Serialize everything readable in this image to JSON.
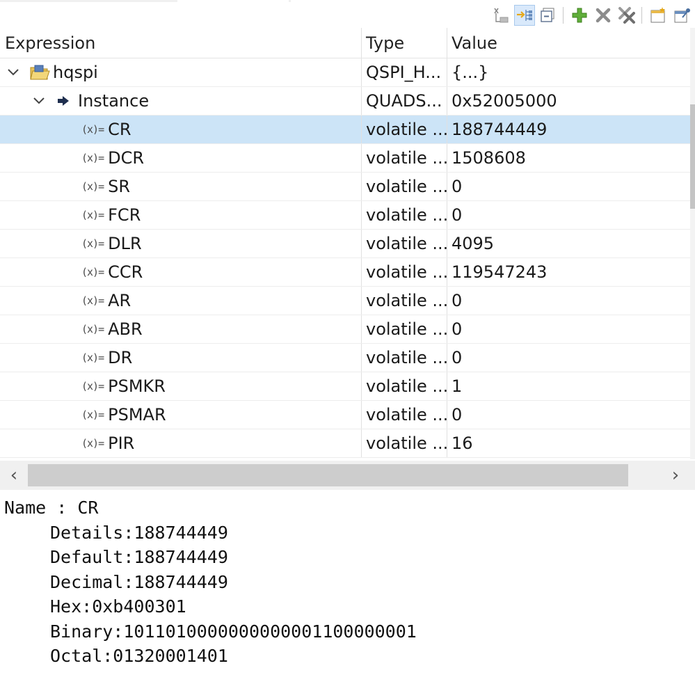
{
  "toolbar": {
    "buttons": [
      {
        "icon": "show-type-names-icon",
        "active": false
      },
      {
        "icon": "show-logical-structure-icon",
        "active": true
      },
      {
        "icon": "collapse-all-icon",
        "active": false
      },
      {
        "icon": "add-expression-icon",
        "active": false
      },
      {
        "icon": "remove-expression-icon",
        "active": false
      },
      {
        "icon": "remove-all-expressions-icon",
        "active": false
      },
      {
        "icon": "new-view-icon",
        "active": false
      },
      {
        "icon": "pin-view-icon",
        "active": false
      }
    ]
  },
  "table": {
    "headers": {
      "expression": "Expression",
      "type": "Type",
      "value": "Value"
    },
    "root": {
      "name": "hqspi",
      "type": "QSPI_H...",
      "value": "{...}",
      "icon": "struct-folder-icon",
      "expanded": true
    },
    "instance": {
      "name": "Instance",
      "type": "QUADS...",
      "value": "0x52005000",
      "icon": "pointer-arrow-icon",
      "expanded": true
    },
    "registers": [
      {
        "name": "CR",
        "type": "volatile ...",
        "value": "188744449",
        "selected": true
      },
      {
        "name": "DCR",
        "type": "volatile ...",
        "value": "1508608"
      },
      {
        "name": "SR",
        "type": "volatile ...",
        "value": "0"
      },
      {
        "name": "FCR",
        "type": "volatile ...",
        "value": "0"
      },
      {
        "name": "DLR",
        "type": "volatile ...",
        "value": "4095"
      },
      {
        "name": "CCR",
        "type": "volatile ...",
        "value": "119547243"
      },
      {
        "name": "AR",
        "type": "volatile ...",
        "value": "0"
      },
      {
        "name": "ABR",
        "type": "volatile ...",
        "value": "0"
      },
      {
        "name": "DR",
        "type": "volatile ...",
        "value": "0"
      },
      {
        "name": "PSMKR",
        "type": "volatile ...",
        "value": "1"
      },
      {
        "name": "PSMAR",
        "type": "volatile ...",
        "value": "0"
      },
      {
        "name": "PIR",
        "type": "volatile ...",
        "value": "16"
      }
    ],
    "var_icon_glyph": "(x)="
  },
  "details": {
    "name_line": "Name : CR",
    "lines": [
      "Details:188744449",
      "Default:188744449",
      "Decimal:188744449",
      "Hex:0xb400301",
      "Binary:1011010000000000001100000001",
      "Octal:01320001401"
    ]
  },
  "colors": {
    "selection": "#cce4f7",
    "toolbar_active": "#d9e9fb"
  }
}
